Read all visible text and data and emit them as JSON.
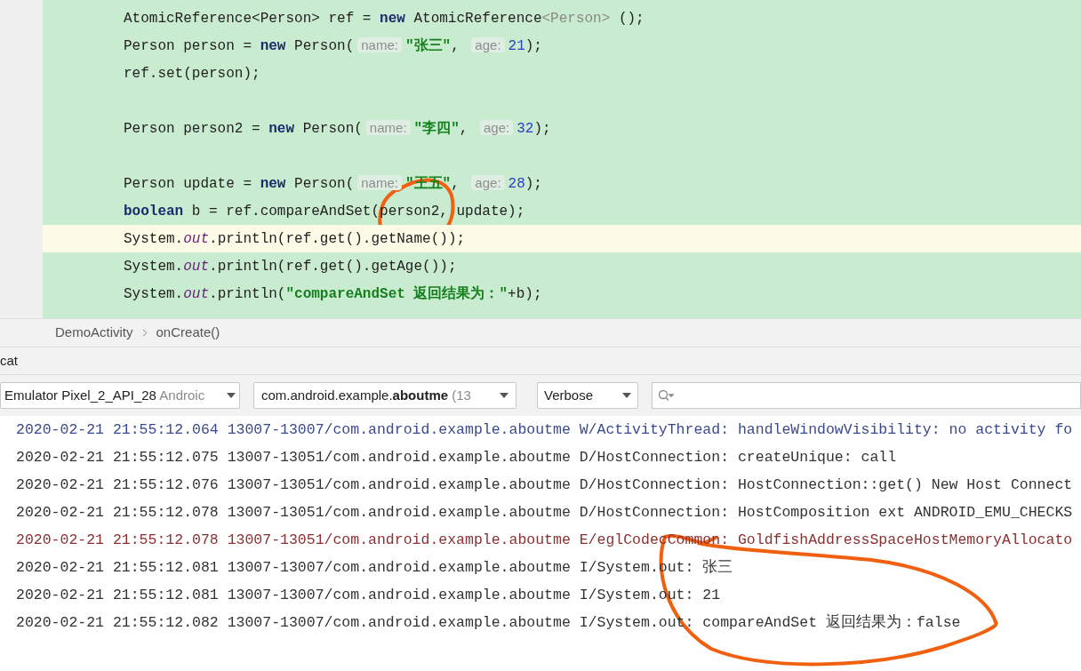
{
  "editor": {
    "lines": [
      {
        "kind": "code",
        "current": false,
        "tokens": [
          {
            "kind": "plain",
            "text": "AtomicReference<Person> ref = "
          },
          {
            "kind": "keyword",
            "text": "new"
          },
          {
            "kind": "plain",
            "text": " AtomicReference"
          },
          {
            "kind": "generic",
            "text": "<Person>"
          },
          {
            "kind": "plain",
            "text": " ();"
          }
        ]
      },
      {
        "kind": "code",
        "current": false,
        "tokens": [
          {
            "kind": "plain",
            "text": "Person person = "
          },
          {
            "kind": "keyword",
            "text": "new"
          },
          {
            "kind": "plain",
            "text": " Person("
          },
          {
            "kind": "hint",
            "text": "name:"
          },
          {
            "kind": "string",
            "text": "\"张三\""
          },
          {
            "kind": "plain",
            "text": ", "
          },
          {
            "kind": "hint",
            "text": "age:"
          },
          {
            "kind": "number",
            "text": "21"
          },
          {
            "kind": "plain",
            "text": ");"
          }
        ]
      },
      {
        "kind": "code",
        "current": false,
        "tokens": [
          {
            "kind": "plain",
            "text": "ref.set(person);"
          }
        ]
      },
      {
        "kind": "blank",
        "current": false
      },
      {
        "kind": "code",
        "current": false,
        "tokens": [
          {
            "kind": "plain",
            "text": "Person person2 = "
          },
          {
            "kind": "keyword",
            "text": "new"
          },
          {
            "kind": "plain",
            "text": " Person("
          },
          {
            "kind": "hint",
            "text": "name:"
          },
          {
            "kind": "string",
            "text": "\"李四\""
          },
          {
            "kind": "plain",
            "text": ", "
          },
          {
            "kind": "hint",
            "text": "age:"
          },
          {
            "kind": "number",
            "text": "32"
          },
          {
            "kind": "plain",
            "text": ");"
          }
        ]
      },
      {
        "kind": "blank",
        "current": false
      },
      {
        "kind": "code",
        "current": false,
        "tokens": [
          {
            "kind": "plain",
            "text": "Person update = "
          },
          {
            "kind": "keyword",
            "text": "new"
          },
          {
            "kind": "plain",
            "text": " Person("
          },
          {
            "kind": "hint",
            "text": "name:"
          },
          {
            "kind": "string",
            "text": "\"王五\""
          },
          {
            "kind": "plain",
            "text": ", "
          },
          {
            "kind": "hint",
            "text": "age:"
          },
          {
            "kind": "number",
            "text": "28"
          },
          {
            "kind": "plain",
            "text": ");"
          }
        ]
      },
      {
        "kind": "code",
        "current": false,
        "tokens": [
          {
            "kind": "keyword",
            "text": "boolean"
          },
          {
            "kind": "plain",
            "text": " b = ref.compareAndSet(person2, update);"
          }
        ]
      },
      {
        "kind": "code",
        "current": true,
        "tokens": [
          {
            "kind": "plain",
            "text": "System."
          },
          {
            "kind": "static",
            "text": "out"
          },
          {
            "kind": "plain",
            "text": ".println(ref.get().getName());"
          }
        ]
      },
      {
        "kind": "code",
        "current": false,
        "tokens": [
          {
            "kind": "plain",
            "text": "System."
          },
          {
            "kind": "static",
            "text": "out"
          },
          {
            "kind": "plain",
            "text": ".println(ref.get().getAge());"
          }
        ]
      },
      {
        "kind": "code",
        "current": false,
        "tokens": [
          {
            "kind": "plain",
            "text": "System."
          },
          {
            "kind": "static",
            "text": "out"
          },
          {
            "kind": "plain",
            "text": ".println("
          },
          {
            "kind": "string",
            "text": "\"compareAndSet 返回结果为：\""
          },
          {
            "kind": "plain",
            "text": "+b);"
          }
        ]
      }
    ]
  },
  "breadcrumbs": [
    "DemoActivity",
    "onCreate()"
  ],
  "panel_title": "cat",
  "logcat": {
    "device": {
      "name": "Emulator Pixel_2_API_28",
      "suffix": "Androic"
    },
    "process": {
      "name": "com.android.example.**aboutme**",
      "suffix": "(13"
    },
    "level": "Verbose",
    "rows": [
      {
        "color": "#3a4a8c",
        "text": "2020-02-21 21:55:12.064 13007-13007/com.android.example.aboutme W/ActivityThread: handleWindowVisibility: no activity fo"
      },
      {
        "color": "#333333",
        "text": "2020-02-21 21:55:12.075 13007-13051/com.android.example.aboutme D/HostConnection: createUnique: call"
      },
      {
        "color": "#333333",
        "text": "2020-02-21 21:55:12.076 13007-13051/com.android.example.aboutme D/HostConnection: HostConnection::get() New Host Connect"
      },
      {
        "color": "#333333",
        "text": "2020-02-21 21:55:12.078 13007-13051/com.android.example.aboutme D/HostConnection: HostComposition ext ANDROID_EMU_CHECKS"
      },
      {
        "color": "#8b3030",
        "text": "2020-02-21 21:55:12.078 13007-13051/com.android.example.aboutme E/eglCodecCommon: GoldfishAddressSpaceHostMemoryAllocato"
      },
      {
        "color": "#333333",
        "text": "2020-02-21 21:55:12.081 13007-13007/com.android.example.aboutme I/System.out: 张三"
      },
      {
        "color": "#333333",
        "text": "2020-02-21 21:55:12.081 13007-13007/com.android.example.aboutme I/System.out: 21"
      },
      {
        "color": "#333333",
        "text": "2020-02-21 21:55:12.082 13007-13007/com.android.example.aboutme I/System.out: compareAndSet 返回结果为：false"
      }
    ]
  }
}
